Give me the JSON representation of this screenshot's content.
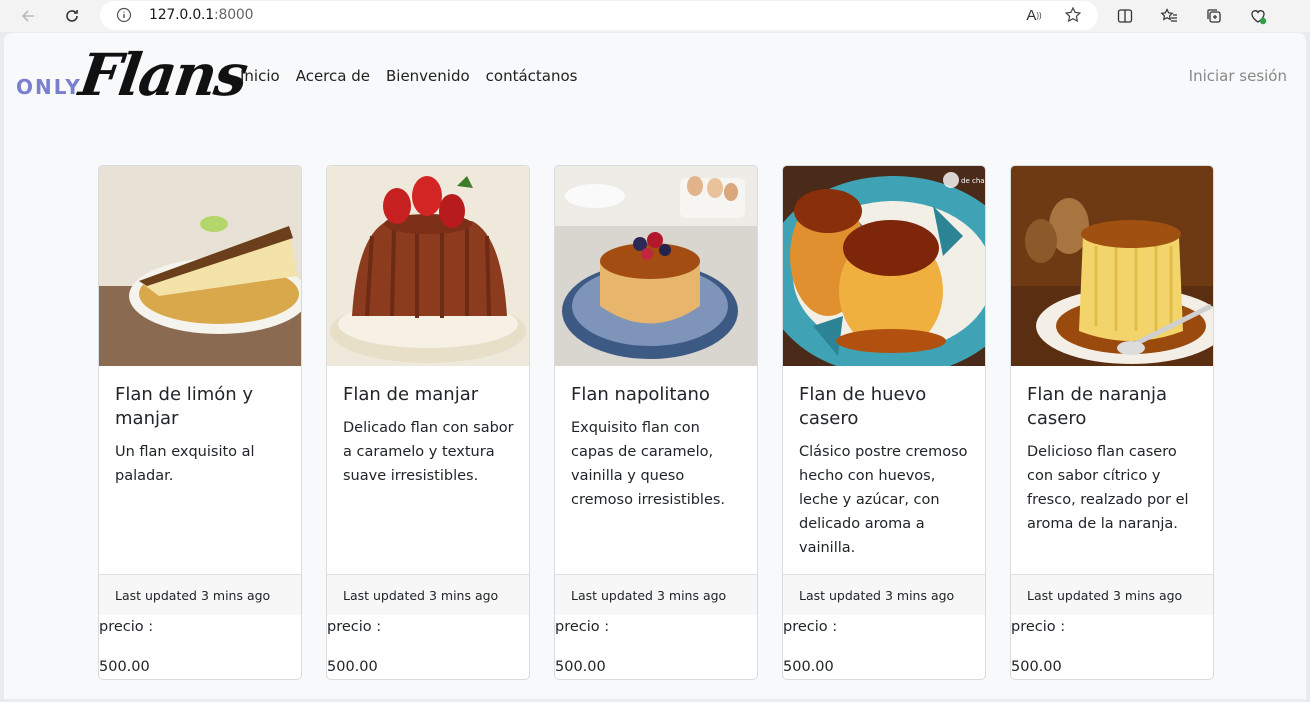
{
  "browser": {
    "url_host": "127.0.0.1",
    "url_port": ":8000",
    "reader_icon_text": "A"
  },
  "navbar": {
    "logo_only": "ONLY",
    "logo_flans": "Flans",
    "links": [
      "Inicio",
      "Acerca de",
      "Bienvenido",
      "contáctanos"
    ],
    "login": "Iniciar sesión"
  },
  "cards": [
    {
      "title": "Flan de limón y manjar",
      "text": "Un flan exquisito al paladar.",
      "footer": "Last updated 3 mins ago",
      "price_label": "precio :",
      "price": "500.00"
    },
    {
      "title": "Flan de manjar",
      "text": "Delicado flan con sabor a caramelo y textura suave irresistibles.",
      "footer": "Last updated 3 mins ago",
      "price_label": "precio :",
      "price": "500.00"
    },
    {
      "title": "Flan napolitano",
      "text": "Exquisito flan con capas de caramelo, vainilla y queso cremoso irresistibles.",
      "footer": "Last updated 3 mins ago",
      "price_label": "precio :",
      "price": "500.00"
    },
    {
      "title": "Flan de huevo casero",
      "text": "Clásico postre cremoso hecho con huevos, leche y azúcar, con delicado aroma a vainilla.",
      "footer": "Last updated 3 mins ago",
      "price_label": "precio :",
      "price": "500.00"
    },
    {
      "title": "Flan de naranja casero",
      "text": "Delicioso flan casero con sabor cítrico y fresco, realzado por el aroma de la naranja.",
      "footer": "Last updated 3 mins ago",
      "price_label": "precio :",
      "price": "500.00"
    }
  ],
  "image_watermark": "de chapete"
}
